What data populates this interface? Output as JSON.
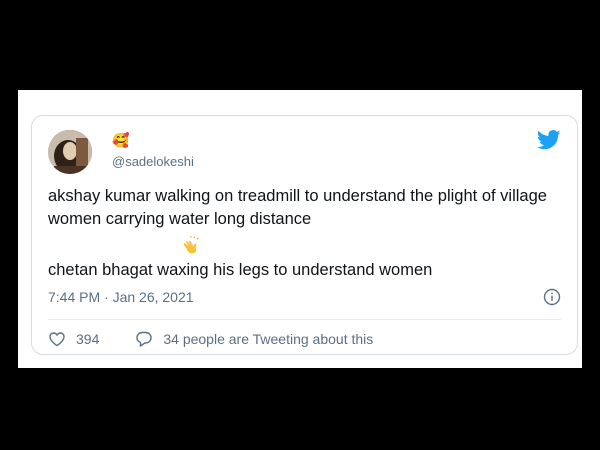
{
  "tweet": {
    "handle": "@sadelokeshi",
    "paragraph1": "akshay kumar walking on treadmill to understand the plight of village women carrying water long distance",
    "paragraph2": "chetan bhagat waxing his legs to understand women",
    "timestamp": "7:44 PM · Jan 26, 2021",
    "name_emoji": "🥰",
    "likes": "394",
    "conversation": "34 people are Tweeting about this"
  },
  "icons": {
    "brand": "twitter-bird-icon",
    "info": "info-icon",
    "like": "heart-icon",
    "reply": "speech-bubble-icon",
    "clap": "clapping-hands-icon"
  },
  "colors": {
    "twitter_blue": "#1da1f2",
    "secondary_text": "#5b7083",
    "primary_text": "#0f1419",
    "clap_yellow": "#f5c33b"
  }
}
